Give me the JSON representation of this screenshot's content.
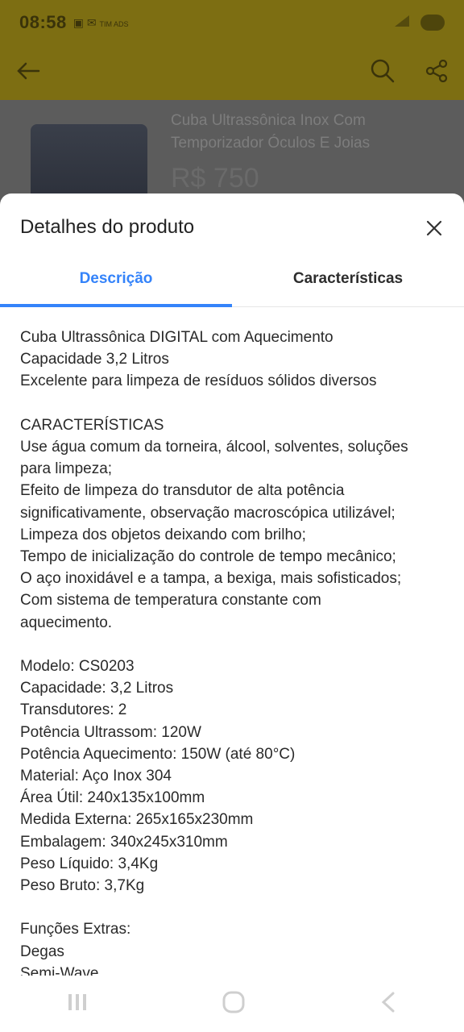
{
  "status_bar": {
    "time": "08:58",
    "notif_text": "TIM ADS"
  },
  "product": {
    "title": "Cuba Ultrassônica Inox Com Temporizador Óculos E Joias",
    "price": "R$ 750"
  },
  "sheet": {
    "title": "Detalhes do produto",
    "tabs": [
      {
        "label": "Descrição",
        "active": true
      },
      {
        "label": "Características",
        "active": false
      }
    ],
    "description_lines": [
      "Cuba Ultrassônica DIGITAL com Aquecimento",
      "Capacidade 3,2 Litros",
      "Excelente para limpeza de resíduos sólidos diversos",
      "",
      "CARACTERÍSTICAS",
      "Use água comum da torneira, álcool, solventes, soluções",
      "para limpeza;",
      "Efeito de limpeza do transdutor de alta potência",
      "significativamente, observação macroscópica utilizável;",
      "Limpeza dos objetos deixando com brilho;",
      "Tempo de inicialização do controle de tempo mecânico;",
      "O aço inoxidável e a tampa, a bexiga, mais sofisticados;",
      "Com sistema de temperatura constante com",
      "aquecimento.",
      "",
      "Modelo: CS0203",
      "Capacidade: 3,2 Litros",
      "Transdutores: 2",
      "Potência Ultrassom: 120W",
      "Potência Aquecimento: 150W (até 80°C)",
      "Material: Aço Inox 304",
      "Área Útil: 240x135x100mm",
      "Medida Externa: 265x165x230mm",
      "Embalagem: 340x245x310mm",
      "Peso Líquido: 3,4Kg",
      "Peso Bruto: 3,7Kg",
      "",
      "Funções Extras:",
      "Degas",
      "Semi-Wave"
    ]
  },
  "colors": {
    "accent": "#3483fa",
    "header_dimmed": "#7d6e12",
    "sheet_bg": "#ffffff"
  }
}
